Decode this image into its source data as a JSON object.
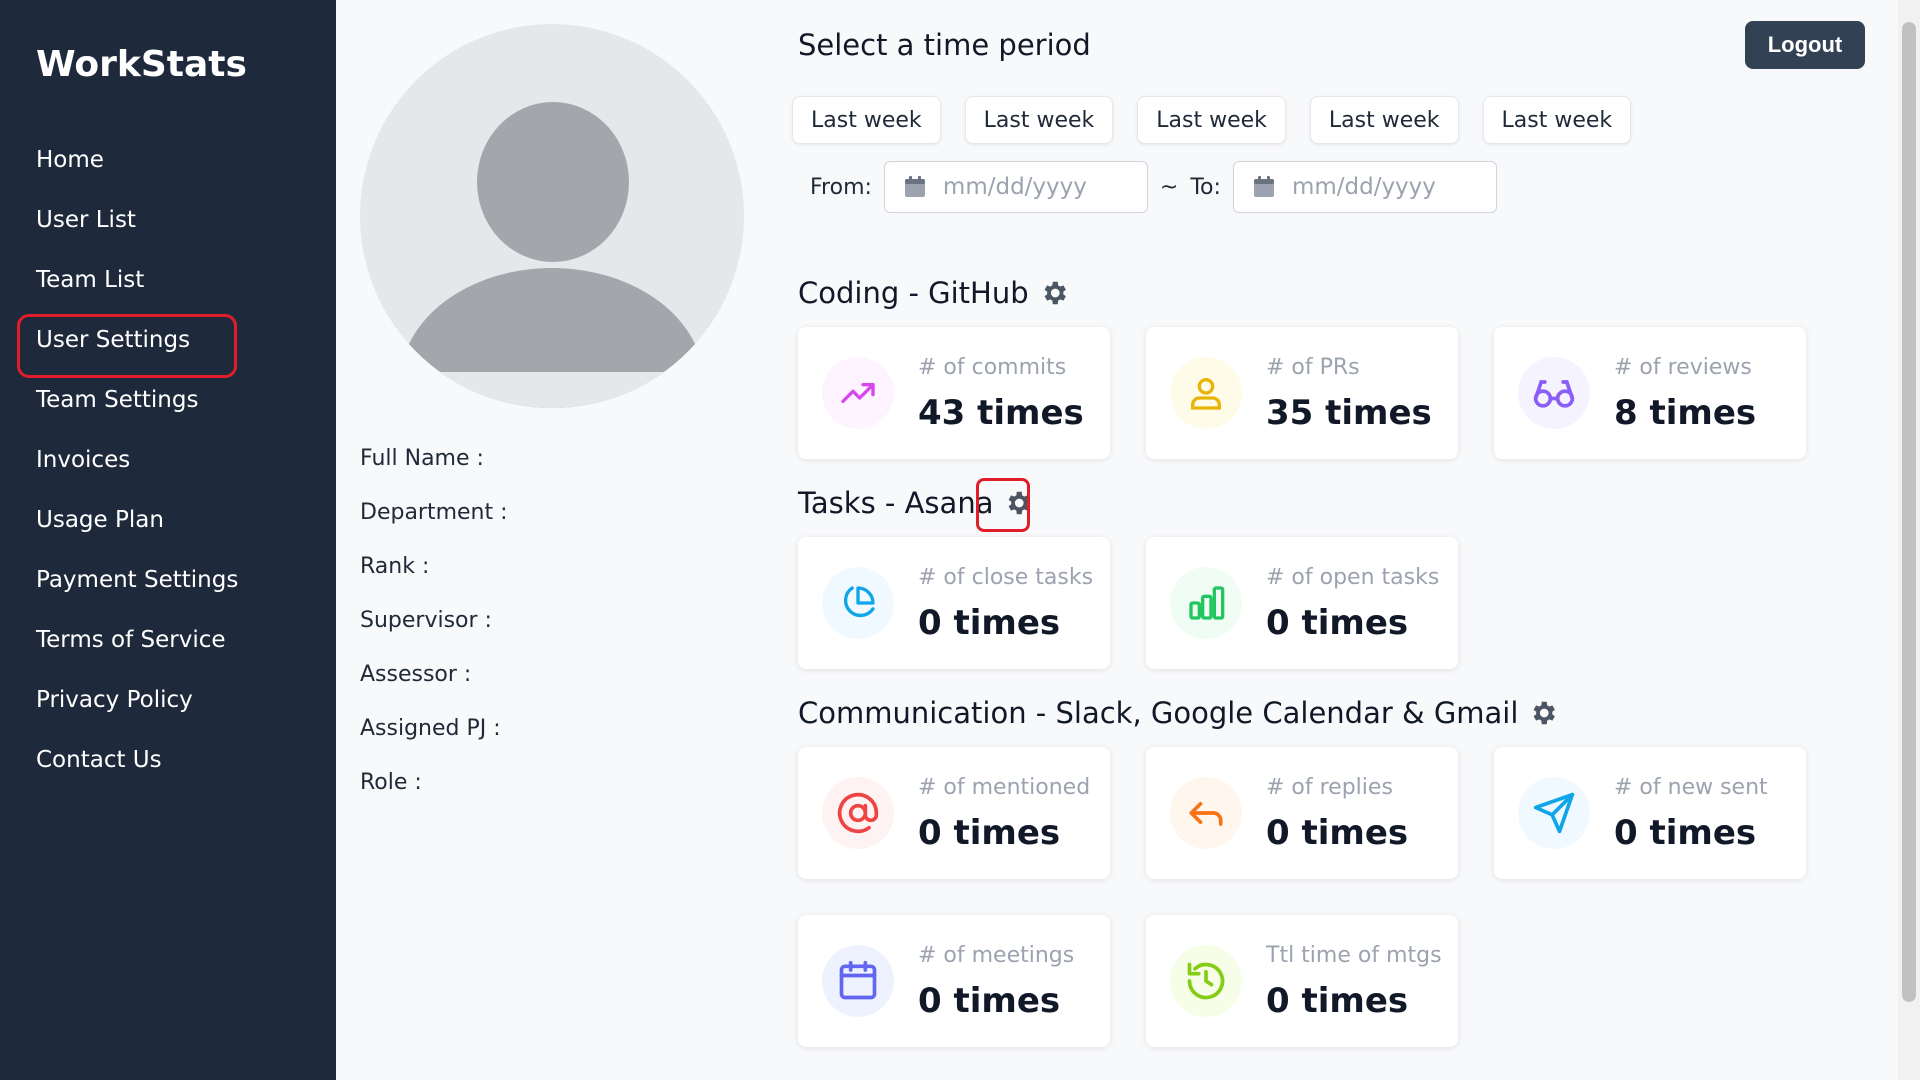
{
  "brand": "WorkStats",
  "nav": [
    {
      "label": "Home"
    },
    {
      "label": "User List"
    },
    {
      "label": "Team List"
    },
    {
      "label": "User Settings"
    },
    {
      "label": "Team Settings"
    },
    {
      "label": "Invoices"
    },
    {
      "label": "Usage Plan"
    },
    {
      "label": "Payment Settings"
    },
    {
      "label": "Terms of Service"
    },
    {
      "label": "Privacy Policy"
    },
    {
      "label": "Contact Us"
    }
  ],
  "profile": {
    "fields": [
      "Full Name :",
      "Department :",
      "Rank :",
      "Supervisor :",
      "Assessor :",
      "Assigned PJ :",
      "Role :"
    ]
  },
  "header": {
    "title": "Select a time period",
    "logout": "Logout",
    "period_buttons": [
      "Last week",
      "Last week",
      "Last week",
      "Last week",
      "Last week"
    ],
    "from_label": "From:",
    "tilde": "~",
    "to_label": "To:",
    "date_placeholder": "mm/dd/yyyy"
  },
  "sections": {
    "coding": {
      "title": "Coding - GitHub",
      "cards": [
        {
          "label": "# of commits",
          "value": "43 times",
          "icon": "trending-up-icon",
          "color": "#d946ef",
          "bg": "#fdf4ff"
        },
        {
          "label": "# of PRs",
          "value": "35 times",
          "icon": "user-icon",
          "color": "#eab308",
          "bg": "#fefce8"
        },
        {
          "label": "# of reviews",
          "value": "8 times",
          "icon": "glasses-icon",
          "color": "#8b5cf6",
          "bg": "#f5f3ff"
        }
      ]
    },
    "tasks": {
      "title": "Tasks - Asana",
      "cards": [
        {
          "label": "# of close tasks",
          "value": "0 times",
          "icon": "pie-chart-icon",
          "color": "#0ea5e9",
          "bg": "#f0f9ff"
        },
        {
          "label": "# of open tasks",
          "value": "0 times",
          "icon": "bar-chart-icon",
          "color": "#22c55e",
          "bg": "#f0fdf4"
        }
      ]
    },
    "communication": {
      "title": "Communication - Slack, Google Calendar & Gmail",
      "cards": [
        {
          "label": "# of mentioned",
          "value": "0 times",
          "icon": "at-sign-icon",
          "color": "#ef4444",
          "bg": "#fef2f2"
        },
        {
          "label": "# of replies",
          "value": "0 times",
          "icon": "reply-icon",
          "color": "#f97316",
          "bg": "#fff7ed"
        },
        {
          "label": "# of new sent",
          "value": "0 times",
          "icon": "send-icon",
          "color": "#0ea5e9",
          "bg": "#f0f9ff"
        },
        {
          "label": "# of meetings",
          "value": "0 times",
          "icon": "calendar-icon",
          "color": "#6366f1",
          "bg": "#eef2ff"
        },
        {
          "label": "Ttl time of mtgs",
          "value": "0 times",
          "icon": "clock-rotate-icon",
          "color": "#84cc16",
          "bg": "#f7fee7"
        }
      ]
    }
  }
}
